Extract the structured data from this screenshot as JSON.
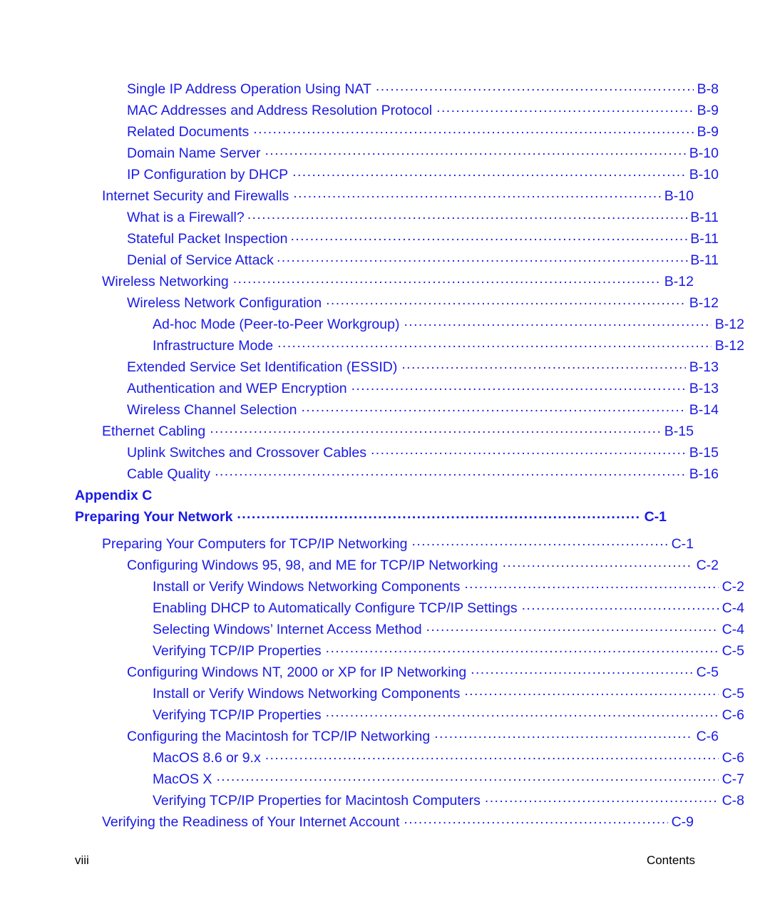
{
  "document": {
    "section_name": "Contents",
    "page_number": "viii"
  },
  "toc": {
    "entries": [
      {
        "title": "Single IP Address Operation Using NAT",
        "page": "B-8",
        "level": 2,
        "bold": false,
        "tight": false
      },
      {
        "title": "MAC Addresses and Address Resolution Protocol",
        "page": "B-9",
        "level": 2,
        "bold": false,
        "tight": false
      },
      {
        "title": "Related Documents",
        "page": "B-9",
        "level": 2,
        "bold": false,
        "tight": false
      },
      {
        "title": "Domain Name Server",
        "page": "B-10",
        "level": 2,
        "bold": false,
        "tight": false
      },
      {
        "title": "IP Configuration by DHCP",
        "page": "B-10",
        "level": 2,
        "bold": false,
        "tight": false
      },
      {
        "title": "Internet Security and Firewalls",
        "page": "B-10",
        "level": 1,
        "bold": false,
        "tight": false
      },
      {
        "title": "What is a Firewall?",
        "page": "B-11",
        "level": 2,
        "bold": false,
        "tight": true
      },
      {
        "title": "Stateful Packet Inspection",
        "page": "B-11",
        "level": 2,
        "bold": false,
        "tight": true
      },
      {
        "title": "Denial of Service Attack",
        "page": "B-11",
        "level": 2,
        "bold": false,
        "tight": true
      },
      {
        "title": "Wireless Networking",
        "page": "B-12",
        "level": 1,
        "bold": false,
        "tight": false
      },
      {
        "title": "Wireless Network Configuration",
        "page": "B-12",
        "level": 2,
        "bold": false,
        "tight": false
      },
      {
        "title": "Ad-hoc Mode (Peer-to-Peer Workgroup)",
        "page": "B-12",
        "level": 3,
        "bold": false,
        "tight": false
      },
      {
        "title": "Infrastructure Mode",
        "page": "B-12",
        "level": 3,
        "bold": false,
        "tight": false
      },
      {
        "title": "Extended Service Set Identification (ESSID)",
        "page": "B-13",
        "level": 2,
        "bold": false,
        "tight": false
      },
      {
        "title": "Authentication and WEP Encryption",
        "page": "B-13",
        "level": 2,
        "bold": false,
        "tight": false
      },
      {
        "title": "Wireless Channel Selection",
        "page": "B-14",
        "level": 2,
        "bold": false,
        "tight": false
      },
      {
        "title": "Ethernet Cabling",
        "page": "B-15",
        "level": 1,
        "bold": false,
        "tight": false
      },
      {
        "title": "Uplink Switches and Crossover Cables",
        "page": "B-15",
        "level": 2,
        "bold": false,
        "tight": false
      },
      {
        "title": "Cable Quality",
        "page": "B-16",
        "level": 2,
        "bold": false,
        "tight": false
      }
    ],
    "appendix": {
      "label": "Appendix C",
      "title": "Preparing Your Network",
      "page": "C-1",
      "entries": [
        {
          "title": "Preparing Your Computers for TCP/IP Networking",
          "page": "C-1",
          "level": 1,
          "bold": false,
          "tight": false
        },
        {
          "title": "Configuring Windows 95, 98, and ME for TCP/IP Networking",
          "page": "C-2",
          "level": 2,
          "bold": false,
          "tight": false
        },
        {
          "title": "Install or Verify Windows Networking Components",
          "page": "C-2",
          "level": 3,
          "bold": false,
          "tight": false
        },
        {
          "title": "Enabling DHCP to Automatically Configure TCP/IP Settings",
          "page": "C-4",
          "level": 3,
          "bold": false,
          "tight": false
        },
        {
          "title": "Selecting Windows’ Internet Access Method",
          "page": "C-4",
          "level": 3,
          "bold": false,
          "tight": false
        },
        {
          "title": "Verifying TCP/IP Properties",
          "page": "C-5",
          "level": 3,
          "bold": false,
          "tight": false
        },
        {
          "title": "Configuring Windows NT, 2000 or XP for IP Networking",
          "page": "C-5",
          "level": 2,
          "bold": false,
          "tight": false
        },
        {
          "title": "Install or Verify Windows Networking Components",
          "page": "C-5",
          "level": 3,
          "bold": false,
          "tight": false
        },
        {
          "title": "Verifying TCP/IP Properties",
          "page": "C-6",
          "level": 3,
          "bold": false,
          "tight": false
        },
        {
          "title": "Configuring the Macintosh for TCP/IP Networking",
          "page": "C-6",
          "level": 2,
          "bold": false,
          "tight": false
        },
        {
          "title": "MacOS 8.6 or 9.x",
          "page": "C-6",
          "level": 3,
          "bold": false,
          "tight": false
        },
        {
          "title": "MacOS X",
          "page": "C-7",
          "level": 3,
          "bold": false,
          "tight": false
        },
        {
          "title": "Verifying TCP/IP Properties for Macintosh Computers",
          "page": "C-8",
          "level": 3,
          "bold": false,
          "tight": false
        },
        {
          "title": "Verifying the Readiness of Your Internet Account",
          "page": "C-9",
          "level": 1,
          "bold": false,
          "tight": false
        }
      ]
    }
  },
  "colors": {
    "link_blue": "#1a1ae6",
    "footer_black": "#000000",
    "page_background": "#ffffff"
  }
}
